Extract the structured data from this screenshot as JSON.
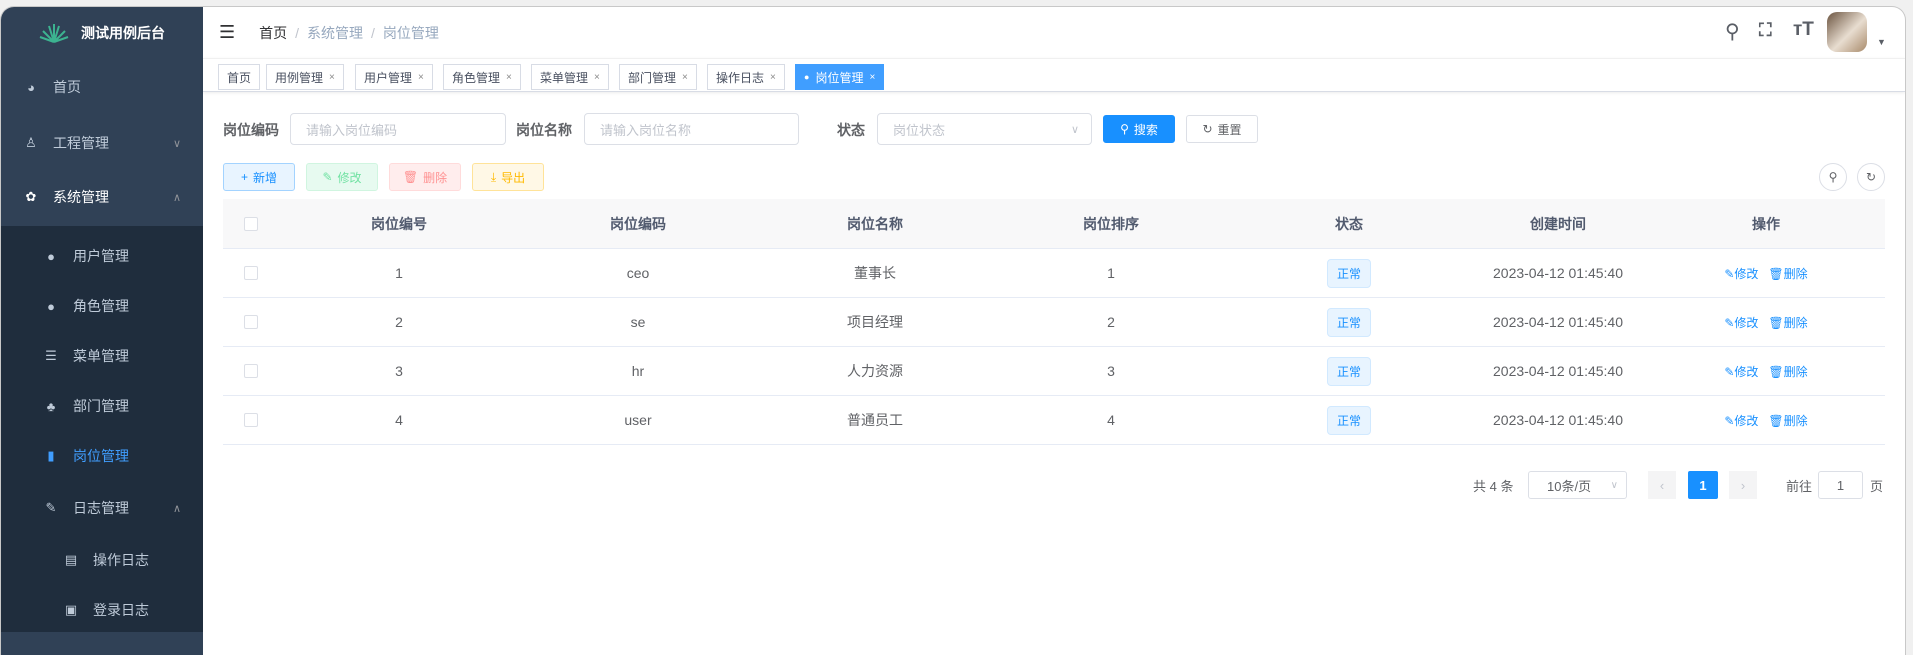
{
  "app": {
    "title": "测试用例后台"
  },
  "sidebar": {
    "items": [
      {
        "label": "首页",
        "icon": "dashboard-icon"
      },
      {
        "label": "工程管理",
        "icon": "project-icon"
      },
      {
        "label": "系统管理",
        "icon": "gear-icon"
      },
      {
        "label": "用户管理",
        "icon": "user-icon"
      },
      {
        "label": "角色管理",
        "icon": "peoples-icon"
      },
      {
        "label": "菜单管理",
        "icon": "tree-table-icon"
      },
      {
        "label": "部门管理",
        "icon": "tree-icon"
      },
      {
        "label": "岗位管理",
        "icon": "post-icon"
      },
      {
        "label": "日志管理",
        "icon": "log-icon"
      },
      {
        "label": "操作日志",
        "icon": "form-icon"
      },
      {
        "label": "登录日志",
        "icon": "logininfor-icon"
      }
    ]
  },
  "breadcrumb": [
    "首页",
    "系统管理",
    "岗位管理"
  ],
  "tabs": [
    "首页",
    "用例管理",
    "用户管理",
    "角色管理",
    "菜单管理",
    "部门管理",
    "操作日志",
    "岗位管理"
  ],
  "search": {
    "code_label": "岗位编码",
    "code_placeholder": "请输入岗位编码",
    "name_label": "岗位名称",
    "name_placeholder": "请输入岗位名称",
    "status_label": "状态",
    "status_placeholder": "岗位状态",
    "search_btn": "搜索",
    "reset_btn": "重置"
  },
  "toolbar": {
    "add": "新增",
    "edit": "修改",
    "delete": "删除",
    "export": "导出"
  },
  "table": {
    "headers": [
      "岗位编号",
      "岗位编码",
      "岗位名称",
      "岗位排序",
      "状态",
      "创建时间",
      "操作"
    ],
    "rows": [
      {
        "id": "1",
        "code": "ceo",
        "name": "董事长",
        "sort": "1",
        "status": "正常",
        "created": "2023-04-12 01:45:40"
      },
      {
        "id": "2",
        "code": "se",
        "name": "项目经理",
        "sort": "2",
        "status": "正常",
        "created": "2023-04-12 01:45:40"
      },
      {
        "id": "3",
        "code": "hr",
        "name": "人力资源",
        "sort": "3",
        "status": "正常",
        "created": "2023-04-12 01:45:40"
      },
      {
        "id": "4",
        "code": "user",
        "name": "普通员工",
        "sort": "4",
        "status": "正常",
        "created": "2023-04-12 01:45:40"
      }
    ],
    "edit": "修改",
    "delete": "删除"
  },
  "pagination": {
    "total": "共 4 条",
    "page_size": "10条/页",
    "current": "1",
    "goto_prefix": "前往",
    "goto_value": "1",
    "goto_suffix": "页"
  },
  "colors": {
    "sidebar": "#304156",
    "submenu": "#1f2d3d",
    "primary": "#1890ff"
  }
}
